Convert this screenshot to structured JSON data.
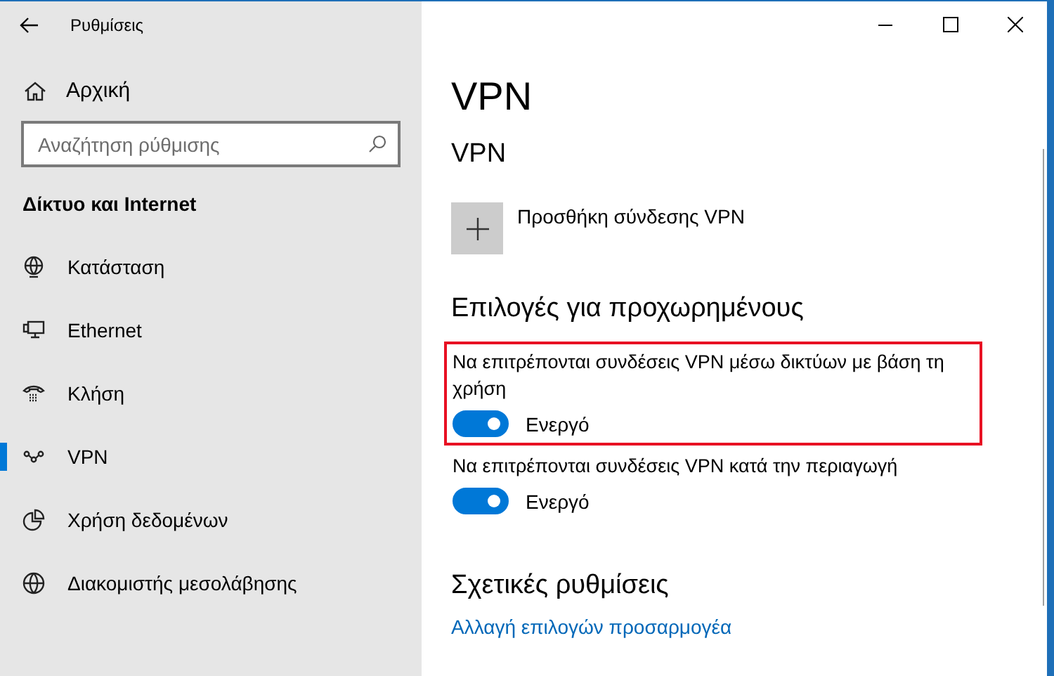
{
  "window": {
    "title": "Ρυθμίσεις"
  },
  "sidebar": {
    "home": "Αρχική",
    "search": {
      "placeholder": "Αναζήτηση ρύθμισης"
    },
    "section": "Δίκτυο και Internet",
    "items": [
      {
        "label": "Κατάσταση",
        "selected": false
      },
      {
        "label": "Ethernet",
        "selected": false
      },
      {
        "label": "Κλήση",
        "selected": false
      },
      {
        "label": "VPN",
        "selected": true
      },
      {
        "label": "Χρήση δεδομένων",
        "selected": false
      },
      {
        "label": "Διακομιστής μεσολάβησης",
        "selected": false
      }
    ]
  },
  "page": {
    "title": "VPN",
    "subtitle": "VPN",
    "add_label": "Προσθήκη σύνδεσης VPN",
    "advanced_heading": "Επιλογές για προχωρημένους",
    "options": [
      {
        "label": "Να επιτρέπονται συνδέσεις VPN μέσω δικτύων με βάση τη χρήση",
        "on": true,
        "state": "Ενεργό",
        "highlighted": true
      },
      {
        "label": "Να επιτρέπονται συνδέσεις VPN κατά την περιαγωγή",
        "on": true,
        "state": "Ενεργό",
        "highlighted": false
      }
    ],
    "related_heading": "Σχετικές ρυθμίσεις",
    "related_link": "Αλλαγή επιλογών προσαρμογέα"
  }
}
